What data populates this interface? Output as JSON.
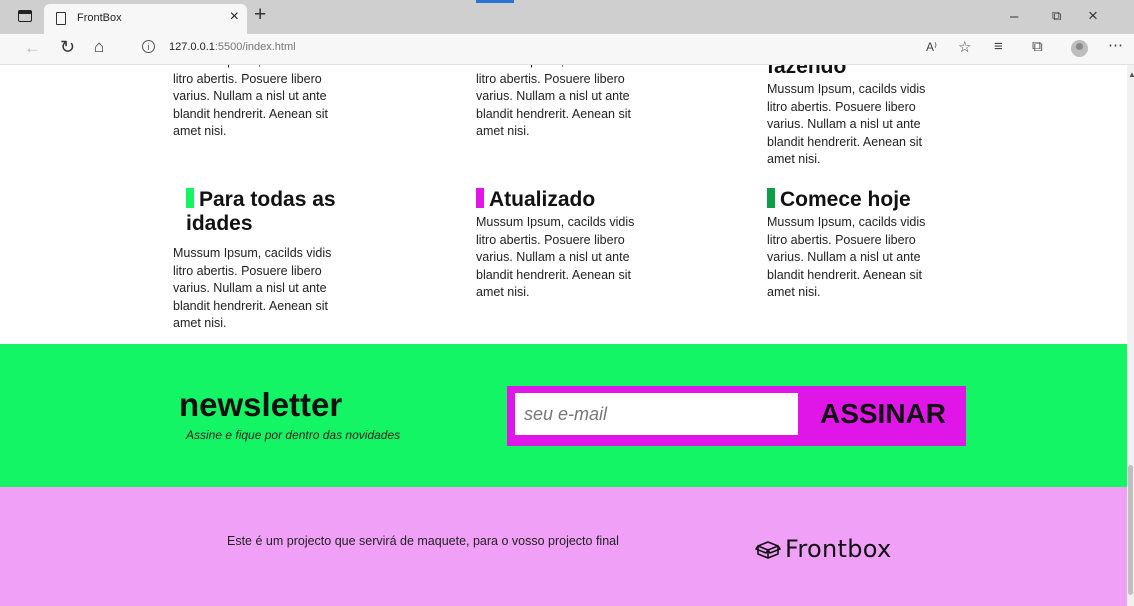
{
  "browser": {
    "tab_title": "FrontBox",
    "tab_close": "×",
    "new_tab": "+",
    "url_host": "127.0.0.1",
    "url_rest": ":5500/index.html",
    "read_aloud": "A⁾"
  },
  "features_top": {
    "cut_heading_right": "fazendo",
    "col1_text": "Mussum Ipsum, cacilds vidis litro abertis. Posuere libero varius. Nullam a nisl ut ante blandit hendrerit. Aenean sit amet nisi.",
    "col2_text": "Mussum Ipsum, cacilds vidis litro abertis. Posuere libero varius. Nullam a nisl ut ante blandit hendrerit. Aenean sit amet nisi.",
    "col3_text": "Mussum Ipsum, cacilds vidis litro abertis. Posuere libero varius. Nullam a nisl ut ante blandit hendrerit. Aenean sit amet nisi."
  },
  "features": [
    {
      "title": "Para todas as idades",
      "text": "Mussum Ipsum, cacilds vidis litro abertis. Posuere libero varius. Nullam a nisl ut ante blandit hendrerit. Aenean sit amet nisi.",
      "accent": "#14f565"
    },
    {
      "title": "Atualizado",
      "text": "Mussum Ipsum, cacilds vidis litro abertis. Posuere libero varius. Nullam a nisl ut ante blandit hendrerit. Aenean sit amet nisi.",
      "accent": "#e015e8"
    },
    {
      "title": "Comece hoje",
      "text": "Mussum Ipsum, cacilds vidis litro abertis. Posuere libero varius. Nullam a nisl ut ante blandit hendrerit. Aenean sit amet nisi.",
      "accent": "#0d9e47"
    }
  ],
  "newsletter": {
    "title": "newsletter",
    "subtitle": "Assine e fique por dentro das novidades",
    "email_placeholder": "seu e-mail",
    "button_label": "ASSINAR",
    "bg_color": "#14f565",
    "form_color": "#e015e8"
  },
  "footer": {
    "text": "Este é um projecto que servirá de maquete, para o vosso projecto final",
    "logo_text": "Frontbox",
    "bg_color": "#f0a1f7"
  },
  "icons": [
    "window-menu-icon",
    "page-icon",
    "back-icon",
    "reload-icon",
    "home-icon",
    "info-icon",
    "read-aloud-icon",
    "add-favorite-icon",
    "favorites-icon",
    "collections-icon",
    "profile-icon",
    "more-icon",
    "box-logo-icon"
  ]
}
